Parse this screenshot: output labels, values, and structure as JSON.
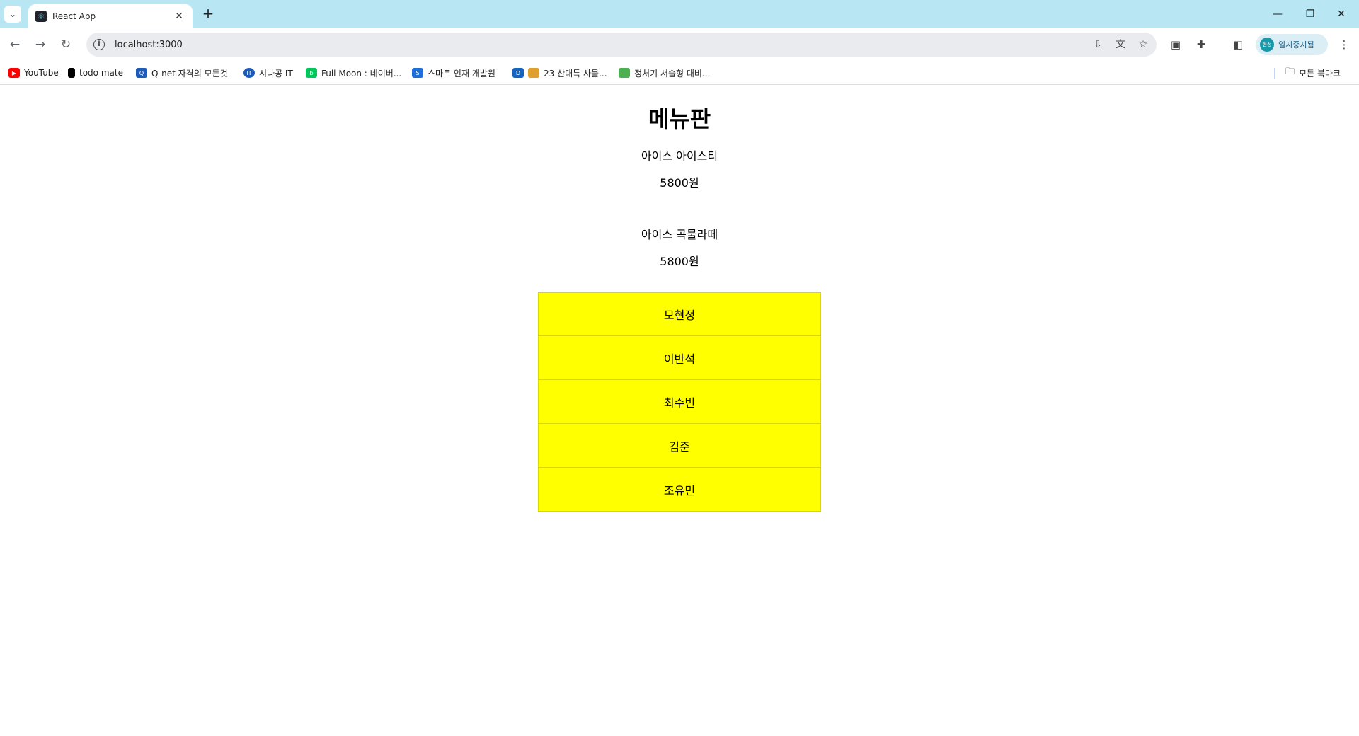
{
  "browser": {
    "tab_title": "React App",
    "url": "localhost:3000",
    "profile_name": "일시중지됨",
    "profile_initials": "현정"
  },
  "bookmarks": [
    {
      "label": "YouTube",
      "icon": "youtube-icon",
      "color": "#ff0000"
    },
    {
      "label": "todo mate",
      "icon": "todo-mate-icon",
      "color": "#000000"
    },
    {
      "label": "Q-net 자격의 모든것",
      "icon": "qnet-icon",
      "color": "#1e5bb8"
    },
    {
      "label": "시나공 IT",
      "icon": "sinagong-icon",
      "color": "#1e5bb8"
    },
    {
      "label": "Full Moon : 네이버...",
      "icon": "naver-blog-icon",
      "color": "#03c75a"
    },
    {
      "label": "스마트 인재 개발원",
      "icon": "smart-hrd-icon",
      "color": "#1e6fd9"
    },
    {
      "label": "23 산대특 사물...",
      "icon": "notion-icon",
      "color": "#1565c0"
    },
    {
      "label": "정처기 서술형 대비...",
      "icon": "book-icon",
      "color": "#4caf50"
    }
  ],
  "all_bookmarks_label": "모든 북마크",
  "page": {
    "title": "메뉴판",
    "menu": [
      {
        "name": "아이스 아이스티",
        "price": "5800원"
      },
      {
        "name": "아이스 곡물라떼",
        "price": "5800원"
      }
    ],
    "names": [
      "모현정",
      "이반석",
      "최수빈",
      "김준",
      "조유민"
    ],
    "highlight_color": "#ffff00"
  }
}
